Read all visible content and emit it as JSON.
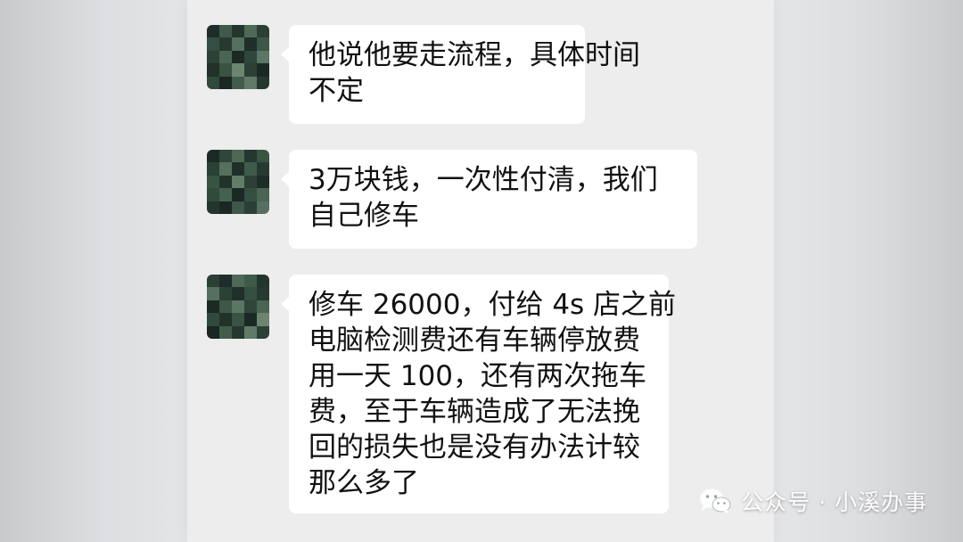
{
  "colors": {
    "chat_background": "#ededed",
    "bubble_background": "#ffffff",
    "text": "#111111",
    "watermark": "#ffffff"
  },
  "messages": [
    {
      "avatar": "pixelated-avatar",
      "lines": [
        "他说他要走流程，具体时间",
        "不定"
      ]
    },
    {
      "avatar": "pixelated-avatar",
      "lines": [
        "3万块钱，一次性付清，我们",
        "自己修车"
      ]
    },
    {
      "avatar": "pixelated-avatar",
      "lines": [
        "修车 26000，付给 4s 店之前",
        "电脑检测费还有车辆停放费",
        "用一天 100，还有两次拖车",
        "费，至于车辆造成了无法挽",
        "回的损失也是没有办法计较",
        "那么多了"
      ]
    }
  ],
  "watermark": {
    "icon": "wechat-logo-icon",
    "text": "公众号 · 小溪办事"
  }
}
